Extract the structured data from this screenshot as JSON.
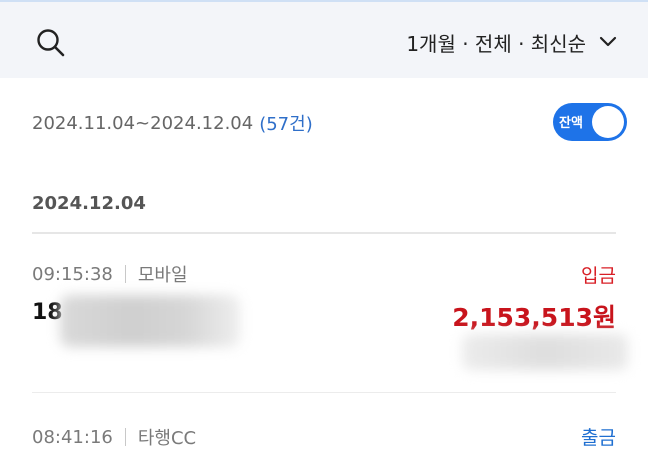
{
  "header": {
    "filter_label": "1개월 · 전체 · 최신순"
  },
  "summary": {
    "date_range": "2024.11.04~2024.12.04",
    "count": "(57건)",
    "balance_toggle_label": "잔액",
    "balance_toggle_on": true
  },
  "groups": [
    {
      "date": "2024.12.04",
      "transactions": [
        {
          "time": "09:15:38",
          "channel": "모바일",
          "type": "입금",
          "name_prefix": "18",
          "amount": "2,153,513원"
        },
        {
          "time": "08:41:16",
          "channel": "타행CC",
          "type": "출금"
        }
      ]
    }
  ],
  "colors": {
    "deposit": "#d81f26",
    "withdrawal": "#1f6fd1",
    "toggle": "#1e73e8",
    "header_bg": "#f3f5f9"
  },
  "icons": {
    "search": "search-icon",
    "filter_expand": "chevron-down-icon"
  }
}
